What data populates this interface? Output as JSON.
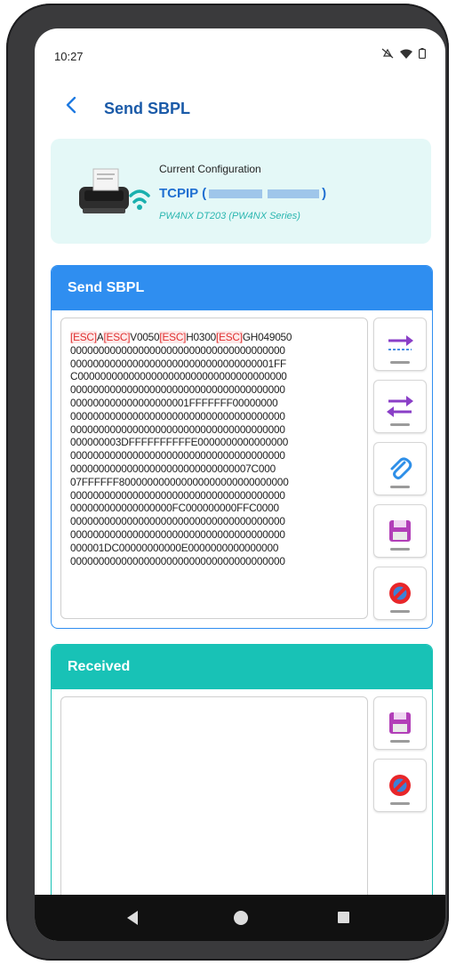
{
  "status_bar": {
    "time": "10:27",
    "icons": [
      "mute-icon",
      "wifi-icon",
      "battery-icon"
    ]
  },
  "app_bar": {
    "back_icon": "chevron-left-icon",
    "title": "Send SBPL"
  },
  "config": {
    "label": "Current Configuration",
    "connection_prefix": "TCPIP (",
    "connection_suffix": ")",
    "model": "PW4NX DT203 (PW4NX Series)"
  },
  "send_panel": {
    "header": "Send SBPL",
    "lines": [
      [
        [
          "esc",
          "[ESC]"
        ],
        [
          "t",
          "A"
        ],
        [
          "esc",
          "[ESC]"
        ],
        [
          "t",
          "V0050"
        ],
        [
          "esc",
          "[ESC]"
        ],
        [
          "t",
          "H0300"
        ],
        [
          "esc",
          "[ESC]"
        ],
        [
          "t",
          "GH049050"
        ]
      ],
      [
        [
          "t",
          "00000000000000000000000000000000000000"
        ]
      ],
      [
        [
          "t",
          "000000000000000000000000000000000001FF"
        ]
      ],
      [
        [
          "t",
          "C0000000000000000000000000000000000000"
        ]
      ],
      [
        [
          "t",
          "00000000000000000000000000000000000000"
        ]
      ],
      [
        [
          "t",
          "000000000000000000001FFFFFFF00000000"
        ]
      ],
      [
        [
          "t",
          "00000000000000000000000000000000000000"
        ]
      ],
      [
        [
          "t",
          "00000000000000000000000000000000000000"
        ]
      ],
      [
        [
          "t",
          "000000003DFFFFFFFFFFE0000000000000000"
        ]
      ],
      [
        [
          "t",
          "00000000000000000000000000000000000000"
        ]
      ],
      [
        [
          "t",
          "00000000000000000000000000000007C000"
        ]
      ],
      [
        [
          "t",
          "07FFFFFF800000000000000000000000000000"
        ]
      ],
      [
        [
          "t",
          "00000000000000000000000000000000000000"
        ]
      ],
      [
        [
          "t",
          "000000000000000000FC000000000FFC0000"
        ]
      ],
      [
        [
          "t",
          "00000000000000000000000000000000000000"
        ]
      ],
      [
        [
          "t",
          "00000000000000000000000000000000000000"
        ]
      ],
      [
        [
          "t",
          "000001DC00000000000E0000000000000000"
        ]
      ],
      [
        [
          "t",
          "00000000000000000000000000000000000000"
        ]
      ]
    ],
    "buttons": [
      {
        "name": "send-single-button",
        "icon": "send-arrow-icon"
      },
      {
        "name": "send-receive-button",
        "icon": "swap-arrows-icon"
      },
      {
        "name": "attach-file-button",
        "icon": "paperclip-icon"
      },
      {
        "name": "save-send-button",
        "icon": "floppy-disk-icon"
      },
      {
        "name": "clear-send-button",
        "icon": "prohibited-icon"
      }
    ]
  },
  "received_panel": {
    "header": "Received",
    "text": "",
    "buttons": [
      {
        "name": "save-received-button",
        "icon": "floppy-disk-icon"
      },
      {
        "name": "clear-received-button",
        "icon": "prohibited-icon"
      }
    ]
  },
  "nav_bar": {
    "icons": [
      "nav-back-icon",
      "nav-home-icon",
      "nav-recents-icon"
    ]
  },
  "colors": {
    "accent_blue": "#2f8ef0",
    "accent_teal": "#18c2b6",
    "esc_red": "#e03030",
    "config_bg": "#e4f8f7"
  }
}
